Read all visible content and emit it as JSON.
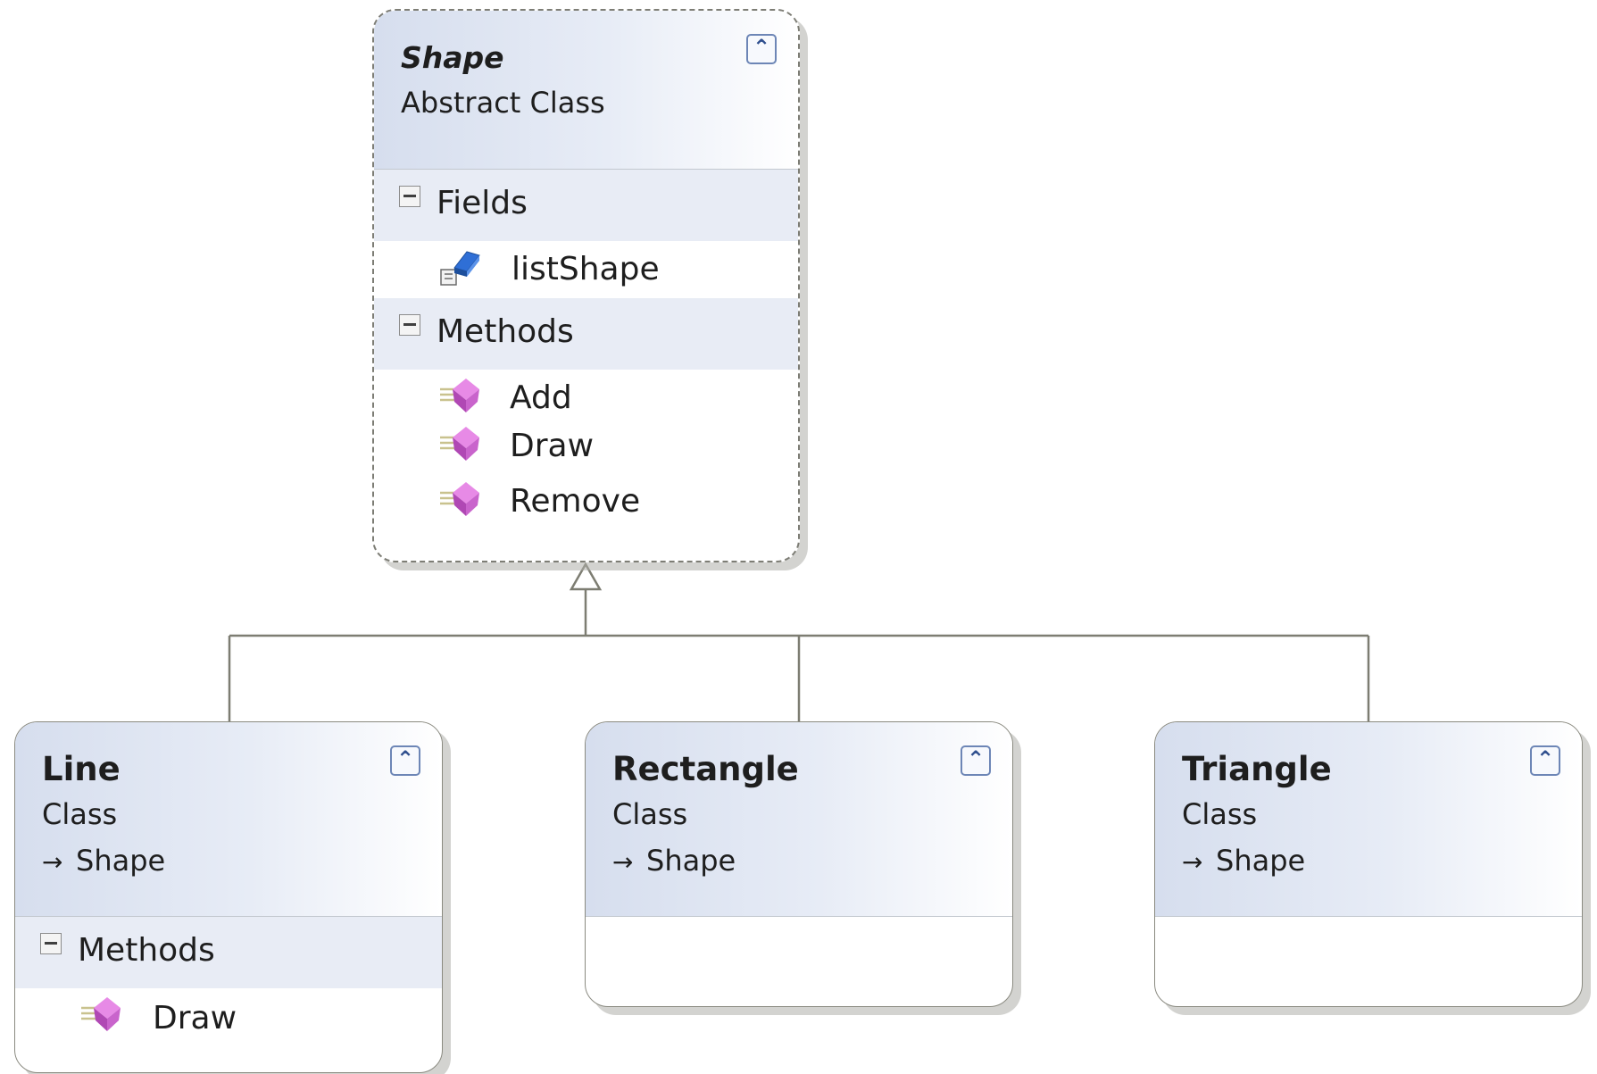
{
  "classes": {
    "shape": {
      "name": "Shape",
      "kind": "Abstract Class",
      "fields_header": "Fields",
      "fields": [
        "listShape"
      ],
      "methods_header": "Methods",
      "methods": [
        "Add",
        "Draw",
        "Remove"
      ]
    },
    "line": {
      "name": "Line",
      "kind": "Class",
      "base": "Shape",
      "methods_header": "Methods",
      "methods": [
        "Draw"
      ]
    },
    "rectangle": {
      "name": "Rectangle",
      "kind": "Class",
      "base": "Shape"
    },
    "triangle": {
      "name": "Triangle",
      "kind": "Class",
      "base": "Shape"
    }
  },
  "relationships": [
    {
      "type": "inheritance",
      "from": "Line",
      "to": "Shape"
    },
    {
      "type": "inheritance",
      "from": "Rectangle",
      "to": "Shape"
    },
    {
      "type": "inheritance",
      "from": "Triangle",
      "to": "Shape"
    }
  ],
  "icons": {
    "collapse": "double-chevron-up-icon",
    "section_toggle": "minus-box-icon",
    "field": "field-icon",
    "method": "method-icon",
    "inherit": "inheritance-arrow-icon"
  },
  "colors": {
    "header_gradient_start": "#d6deee",
    "section_band": "#e8ecf5",
    "border": "#8a8a80",
    "connector": "#7d7d72",
    "method_icon": "#c04cc4",
    "field_icon": "#2f6fd6"
  }
}
